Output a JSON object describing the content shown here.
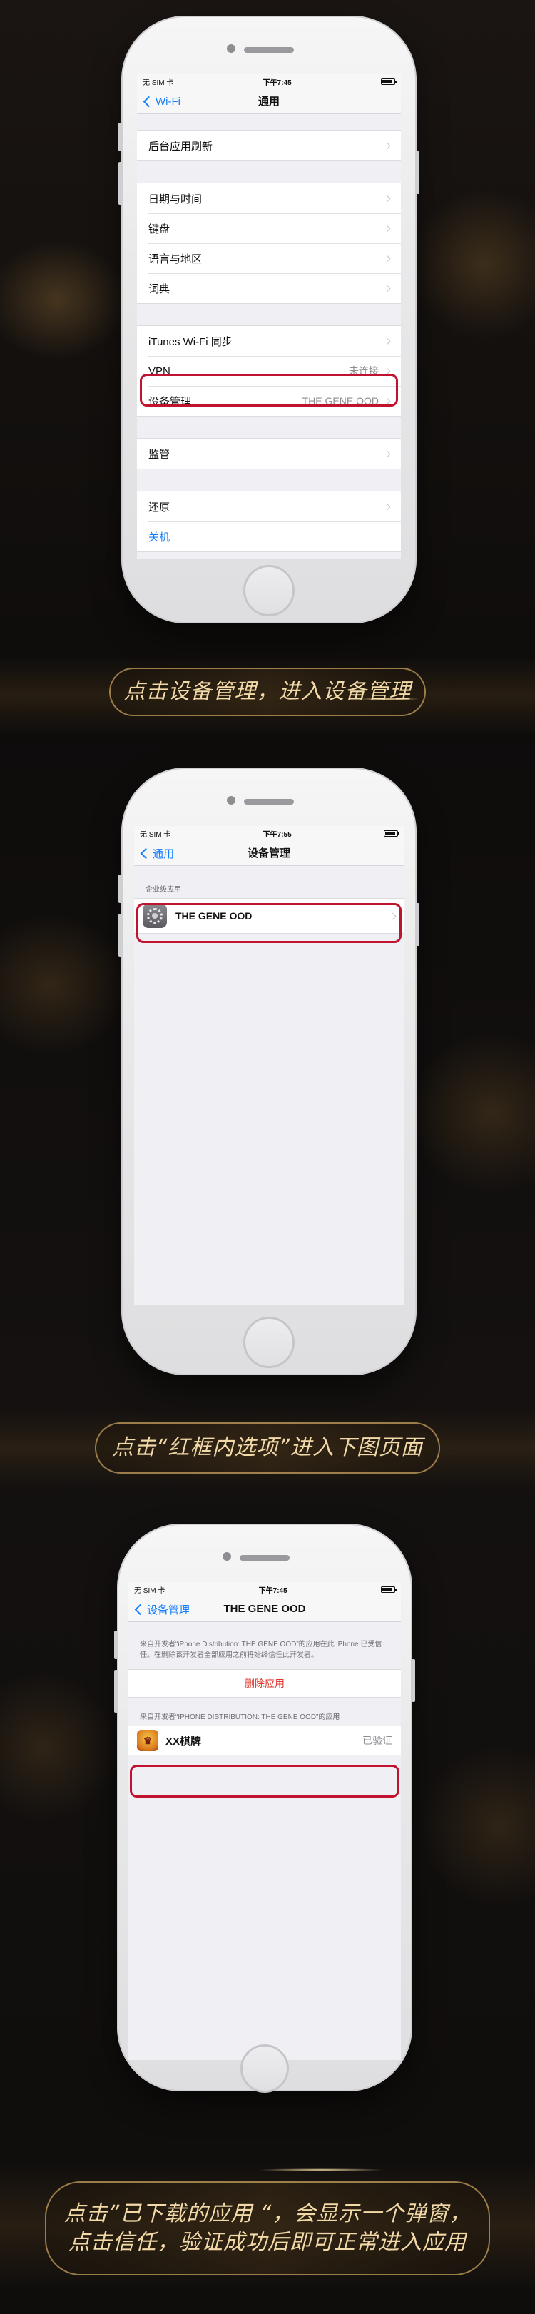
{
  "colors": {
    "accent_blue": "#157efb",
    "highlight_red": "#c1122f",
    "caption_gold": "#f2d9a8",
    "delete_red": "#e2352b"
  },
  "phone1": {
    "status": {
      "carrier": "无 SIM 卡",
      "time": "下午7:45"
    },
    "nav": {
      "back": "Wi-Fi",
      "title": "通用"
    },
    "rows": {
      "bg_refresh": "后台应用刷新",
      "date_time": "日期与时间",
      "keyboard": "键盘",
      "language": "语言与地区",
      "dictionary": "词典",
      "itunes_sync": "iTunes Wi-Fi 同步",
      "vpn": "VPN",
      "vpn_value": "未连接",
      "device_mgmt": "设备管理",
      "device_mgmt_value": "THE GENE OOD",
      "supervision": "监管",
      "reset": "还原",
      "shutdown": "关机"
    }
  },
  "caption1": "点击设备管理，进入设备管理",
  "phone2": {
    "status": {
      "carrier": "无 SIM 卡",
      "time": "下午7:55"
    },
    "nav": {
      "back": "通用",
      "title": "设备管理"
    },
    "section": "企业级应用",
    "app": "THE GENE OOD"
  },
  "caption2": "点击“红框内选项”进入下图页面",
  "phone3": {
    "status": {
      "carrier": "无 SIM 卡",
      "time": "下午7:45"
    },
    "nav": {
      "back": "设备管理",
      "title": "THE GENE OOD"
    },
    "description": "来自开发者“iPhone Distribution: THE GENE OOD”的应用在此 iPhone 已受信任。在删除该开发者全部应用之前将始终信任此开发者。",
    "delete": "删除应用",
    "apps_header": "来自开发者“IPHONE DISTRIBUTION: THE GENE OOD”的应用",
    "app_name": "XX棋牌",
    "app_status": "已验证"
  },
  "caption3": {
    "line1": "点击”已下载的应用 “，会显示一个弹窗，",
    "line2": "点击信任，验证成功后即可正常进入应用"
  }
}
